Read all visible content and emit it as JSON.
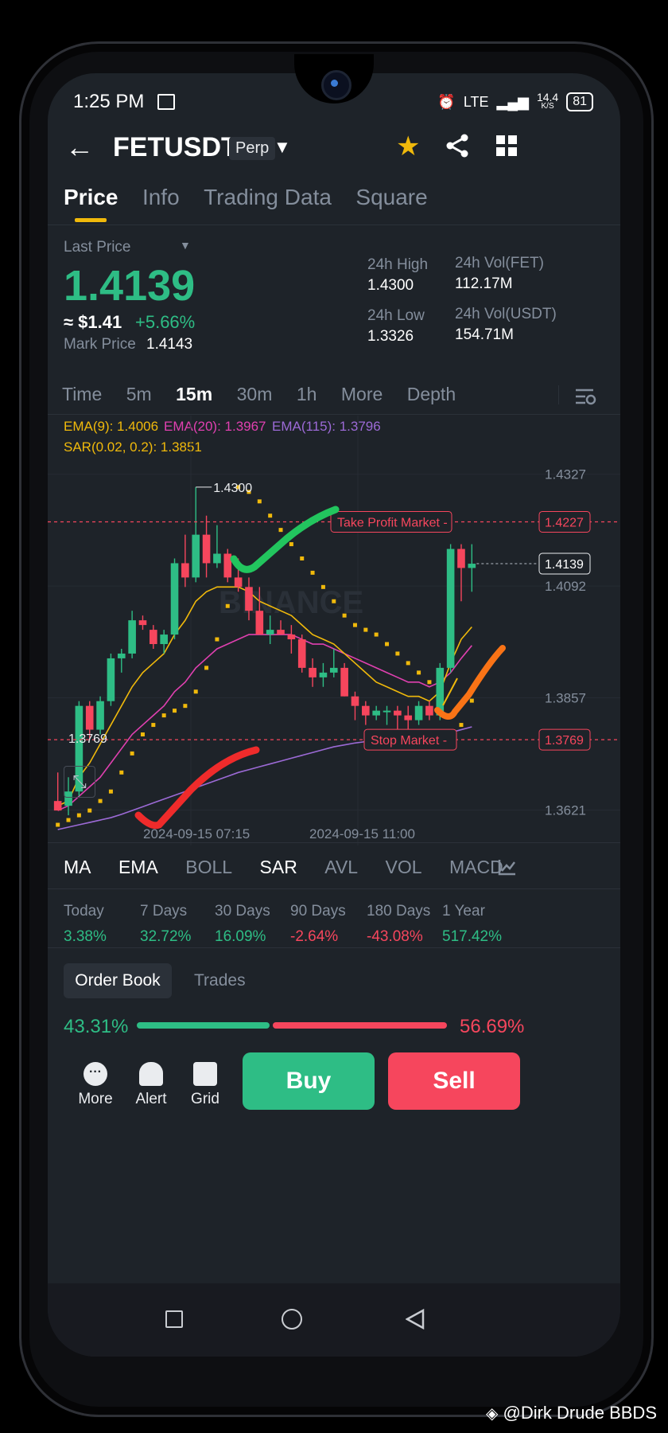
{
  "status": {
    "time": "1:25 PM",
    "network": "LTE",
    "speed": "14.4",
    "speed_unit": "K/S",
    "battery": "81"
  },
  "header": {
    "symbol": "FETUSDT",
    "contract": "Perp"
  },
  "tabs": [
    "Price",
    "Info",
    "Trading Data",
    "Square"
  ],
  "ticker": {
    "last_price_label": "Last Price",
    "last_price": "1.4139",
    "usd_price": "≈ $1.41",
    "change": "+5.66%",
    "mark_price_label": "Mark Price",
    "mark_price": "1.4143",
    "high_label": "24h High",
    "high": "1.4300",
    "low_label": "24h Low",
    "low": "1.3326",
    "vol_fet_label": "24h Vol(FET)",
    "vol_fet": "112.17M",
    "vol_usdt_label": "24h Vol(USDT)",
    "vol_usdt": "154.71M"
  },
  "timeframes": [
    "Time",
    "15m",
    "30m",
    "1h",
    "More",
    "Depth"
  ],
  "timeframe_5m": "5m",
  "indicators_legend": {
    "ema9": "EMA(9): 1.4006",
    "ema20": "EMA(20): 1.3967",
    "ema115": "EMA(115): 1.3796",
    "sar": "SAR(0.02, 0.2): 1.3851"
  },
  "chart": {
    "watermark": "BINANCE",
    "price_labels": [
      "1.4327",
      "1.4092",
      "1.3857",
      "1.3621"
    ],
    "take_profit_label": "Take Profit Market",
    "take_profit_price": "1.4227",
    "stop_label": "Stop Market",
    "stop_price": "1.3769",
    "current_price": "1.4139",
    "high_marker": "1.4300",
    "low_marker": "1.3769",
    "dates": [
      "2024-09-15 07:15",
      "2024-09-15 11:00"
    ],
    "colors": {
      "up": "#2ebd85",
      "down": "#f6465d",
      "ema9": "#f0b90b",
      "ema20": "#e040b0",
      "ema115": "#9c6ad6",
      "sar": "#f0b90b"
    }
  },
  "chart_data": {
    "type": "candlestick",
    "ylim": [
      1.358,
      1.435
    ],
    "candles": [
      {
        "o": 1.364,
        "h": 1.37,
        "l": 1.362,
        "c": 1.362
      },
      {
        "o": 1.363,
        "h": 1.369,
        "l": 1.361,
        "c": 1.366
      },
      {
        "o": 1.366,
        "h": 1.385,
        "l": 1.365,
        "c": 1.384
      },
      {
        "o": 1.384,
        "h": 1.385,
        "l": 1.377,
        "c": 1.379
      },
      {
        "o": 1.379,
        "h": 1.386,
        "l": 1.378,
        "c": 1.385
      },
      {
        "o": 1.385,
        "h": 1.395,
        "l": 1.384,
        "c": 1.394
      },
      {
        "o": 1.394,
        "h": 1.396,
        "l": 1.391,
        "c": 1.395
      },
      {
        "o": 1.395,
        "h": 1.404,
        "l": 1.394,
        "c": 1.402
      },
      {
        "o": 1.402,
        "h": 1.403,
        "l": 1.4,
        "c": 1.401
      },
      {
        "o": 1.4,
        "h": 1.401,
        "l": 1.396,
        "c": 1.397
      },
      {
        "o": 1.397,
        "h": 1.4,
        "l": 1.395,
        "c": 1.399
      },
      {
        "o": 1.399,
        "h": 1.415,
        "l": 1.398,
        "c": 1.414
      },
      {
        "o": 1.414,
        "h": 1.42,
        "l": 1.409,
        "c": 1.411
      },
      {
        "o": 1.411,
        "h": 1.43,
        "l": 1.41,
        "c": 1.42
      },
      {
        "o": 1.42,
        "h": 1.424,
        "l": 1.411,
        "c": 1.414
      },
      {
        "o": 1.414,
        "h": 1.422,
        "l": 1.413,
        "c": 1.416
      },
      {
        "o": 1.416,
        "h": 1.417,
        "l": 1.41,
        "c": 1.411
      },
      {
        "o": 1.411,
        "h": 1.415,
        "l": 1.408,
        "c": 1.409
      },
      {
        "o": 1.409,
        "h": 1.411,
        "l": 1.402,
        "c": 1.404
      },
      {
        "o": 1.404,
        "h": 1.409,
        "l": 1.399,
        "c": 1.399
      },
      {
        "o": 1.399,
        "h": 1.403,
        "l": 1.397,
        "c": 1.4
      },
      {
        "o": 1.4,
        "h": 1.402,
        "l": 1.399,
        "c": 1.399
      },
      {
        "o": 1.399,
        "h": 1.401,
        "l": 1.395,
        "c": 1.398
      },
      {
        "o": 1.398,
        "h": 1.399,
        "l": 1.391,
        "c": 1.392
      },
      {
        "o": 1.392,
        "h": 1.394,
        "l": 1.388,
        "c": 1.39
      },
      {
        "o": 1.39,
        "h": 1.393,
        "l": 1.388,
        "c": 1.391
      },
      {
        "o": 1.391,
        "h": 1.396,
        "l": 1.39,
        "c": 1.392
      },
      {
        "o": 1.392,
        "h": 1.393,
        "l": 1.386,
        "c": 1.386
      },
      {
        "o": 1.386,
        "h": 1.387,
        "l": 1.381,
        "c": 1.384
      },
      {
        "o": 1.384,
        "h": 1.385,
        "l": 1.38,
        "c": 1.382
      },
      {
        "o": 1.382,
        "h": 1.384,
        "l": 1.381,
        "c": 1.383
      },
      {
        "o": 1.383,
        "h": 1.384,
        "l": 1.38,
        "c": 1.383
      },
      {
        "o": 1.383,
        "h": 1.384,
        "l": 1.379,
        "c": 1.382
      },
      {
        "o": 1.382,
        "h": 1.384,
        "l": 1.378,
        "c": 1.381
      },
      {
        "o": 1.381,
        "h": 1.385,
        "l": 1.38,
        "c": 1.384
      },
      {
        "o": 1.384,
        "h": 1.385,
        "l": 1.381,
        "c": 1.382
      },
      {
        "o": 1.382,
        "h": 1.393,
        "l": 1.381,
        "c": 1.392
      },
      {
        "o": 1.392,
        "h": 1.418,
        "l": 1.391,
        "c": 1.417
      },
      {
        "o": 1.417,
        "h": 1.418,
        "l": 1.406,
        "c": 1.413
      },
      {
        "o": 1.413,
        "h": 1.418,
        "l": 1.408,
        "c": 1.4139
      }
    ],
    "ema9": [
      1.363,
      1.364,
      1.369,
      1.372,
      1.376,
      1.38,
      1.384,
      1.388,
      1.391,
      1.393,
      1.395,
      1.399,
      1.402,
      1.406,
      1.408,
      1.409,
      1.409,
      1.409,
      1.408,
      1.406,
      1.405,
      1.404,
      1.403,
      1.401,
      1.399,
      1.398,
      1.397,
      1.395,
      1.393,
      1.391,
      1.389,
      1.388,
      1.387,
      1.386,
      1.386,
      1.385,
      1.387,
      1.393,
      1.398,
      1.4006
    ],
    "ema20": [
      1.362,
      1.363,
      1.365,
      1.367,
      1.369,
      1.372,
      1.375,
      1.378,
      1.38,
      1.382,
      1.384,
      1.387,
      1.389,
      1.392,
      1.394,
      1.396,
      1.397,
      1.398,
      1.399,
      1.399,
      1.399,
      1.399,
      1.399,
      1.398,
      1.397,
      1.397,
      1.396,
      1.395,
      1.394,
      1.393,
      1.392,
      1.391,
      1.39,
      1.389,
      1.389,
      1.388,
      1.389,
      1.391,
      1.394,
      1.3967
    ],
    "ema115": [
      1.358,
      1.3585,
      1.359,
      1.3595,
      1.36,
      1.3605,
      1.3612,
      1.362,
      1.3628,
      1.3636,
      1.3644,
      1.3652,
      1.366,
      1.3668,
      1.3676,
      1.3684,
      1.3692,
      1.37,
      1.3706,
      1.3712,
      1.3718,
      1.3724,
      1.373,
      1.3736,
      1.3742,
      1.3748,
      1.3754,
      1.3758,
      1.3762,
      1.3765,
      1.3768,
      1.377,
      1.3772,
      1.3774,
      1.3776,
      1.3778,
      1.378,
      1.3784,
      1.379,
      1.3796
    ],
    "sar": [
      1.359,
      1.36,
      1.361,
      1.362,
      1.364,
      1.366,
      1.37,
      1.374,
      1.378,
      1.38,
      1.382,
      1.383,
      1.384,
      1.387,
      1.392,
      1.398,
      1.405,
      1.43,
      1.429,
      1.427,
      1.424,
      1.421,
      1.418,
      1.415,
      1.412,
      1.409,
      1.406,
      1.403,
      1.401,
      1.4,
      1.399,
      1.397,
      1.395,
      1.393,
      1.391,
      1.389,
      1.376,
      1.377,
      1.38,
      1.3851
    ]
  },
  "indicator_tabs": [
    "MA",
    "EMA",
    "BOLL",
    "SAR",
    "AVL",
    "VOL",
    "MACD"
  ],
  "performance": [
    {
      "label": "Today",
      "value": "3.38%"
    },
    {
      "label": "7 Days",
      "value": "32.72%"
    },
    {
      "label": "30 Days",
      "value": "16.09%"
    },
    {
      "label": "90 Days",
      "value": "-2.64%"
    },
    {
      "label": "180 Days",
      "value": "-43.08%"
    },
    {
      "label": "1 Year",
      "value": "517.42%"
    }
  ],
  "book": {
    "tab_orderbook": "Order Book",
    "tab_trades": "Trades",
    "buy_pct": "43.31%",
    "sell_pct": "56.69%",
    "buy_ratio": 0.4331
  },
  "toolbar": {
    "more": "More",
    "alert": "Alert",
    "grid": "Grid",
    "buy": "Buy",
    "sell": "Sell"
  },
  "watermark_credit": "@Dirk Drude BBDS"
}
